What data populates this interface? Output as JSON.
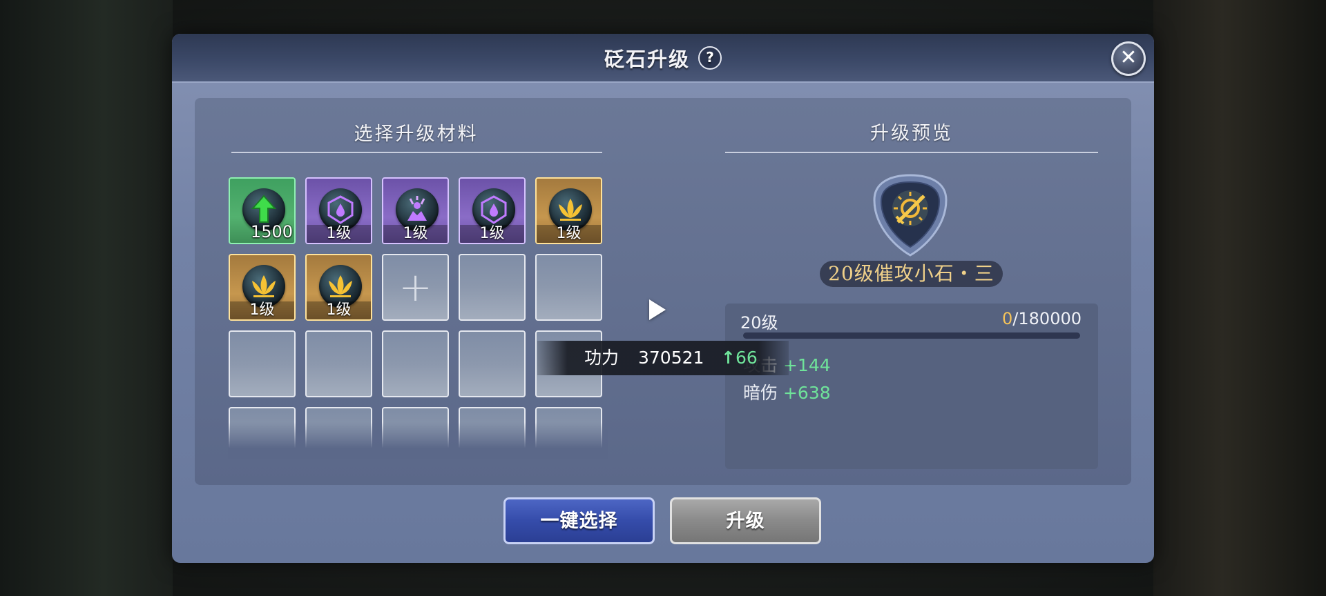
{
  "dialog": {
    "title": "砭石升级",
    "help_label": "?",
    "close_label": "✕"
  },
  "materials": {
    "section_title": "选择升级材料",
    "slots": [
      {
        "type": "green",
        "icon": "upgrade-arrow-icon",
        "quantity": "1500"
      },
      {
        "type": "purple",
        "icon": "shield-drop-icon",
        "level": "1级"
      },
      {
        "type": "purple",
        "icon": "burst-figure-icon",
        "level": "1级"
      },
      {
        "type": "purple",
        "icon": "shield-drop-icon",
        "level": "1级"
      },
      {
        "type": "gold",
        "icon": "lotus-icon",
        "level": "1级"
      },
      {
        "type": "gold",
        "icon": "lotus-icon",
        "level": "1级"
      },
      {
        "type": "gold",
        "icon": "lotus-icon",
        "level": "1级"
      },
      {
        "type": "add",
        "icon": "plus-icon"
      }
    ]
  },
  "preview": {
    "section_title": "升级预览",
    "gem_icon": "sun-sword-icon",
    "gem_name": "20级催攻小石・三",
    "level": "20级",
    "exp_current": "0",
    "exp_max": "/180000",
    "exp_fraction": 0,
    "stats": [
      {
        "label": "攻击",
        "value": "+144"
      },
      {
        "label": "暗伤",
        "value": "+638"
      }
    ]
  },
  "tooltip": {
    "label": "功力",
    "value": "370521",
    "arrow": "↑",
    "increase": "66"
  },
  "buttons": {
    "auto_select": "一键选择",
    "upgrade": "升级"
  },
  "colors": {
    "dialog_bg": "#7382a6",
    "accent_gold": "#f3c25a",
    "stat_green": "#6fe39a",
    "button_blue": "#354caa"
  }
}
